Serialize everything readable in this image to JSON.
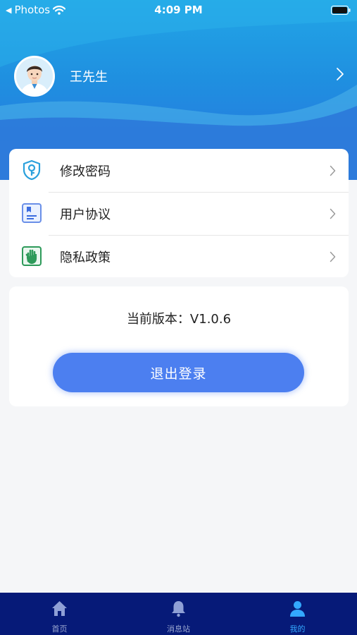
{
  "status_bar": {
    "back_app": "Photos",
    "time": "4:09 PM"
  },
  "profile": {
    "name": "王先生"
  },
  "menu": [
    {
      "label": "修改密码",
      "icon": "shield-key-icon"
    },
    {
      "label": "用户协议",
      "icon": "document-icon"
    },
    {
      "label": "隐私政策",
      "icon": "hand-icon"
    }
  ],
  "version": {
    "text": "当前版本：V1.0.6"
  },
  "logout": {
    "label": "退出登录"
  },
  "tabs": [
    {
      "label": "首页",
      "icon": "home-icon",
      "active": false
    },
    {
      "label": "消息站",
      "icon": "bell-icon",
      "active": false
    },
    {
      "label": "我的",
      "icon": "user-icon",
      "active": true
    }
  ],
  "colors": {
    "header_gradient_top": "#22a6e6",
    "header_gradient_bottom": "#2a74de",
    "primary_button": "#4c7ff0",
    "tab_bar": "#061a78",
    "tab_active": "#33a8ff"
  }
}
